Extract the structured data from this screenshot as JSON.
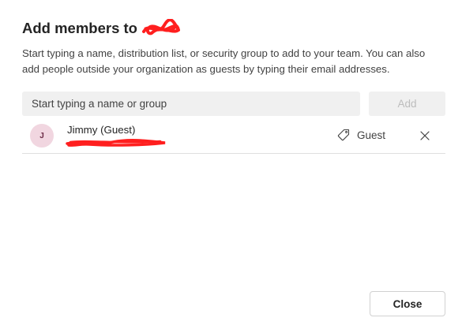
{
  "dialog": {
    "title": "Add members to",
    "description": "Start typing a name, distribution list, or security group to add to your team. You can also add people outside your organization as guests by typing their email addresses."
  },
  "search": {
    "placeholder": "Start typing a name or group",
    "value": ""
  },
  "add_button": {
    "label": "Add"
  },
  "members": [
    {
      "initial": "J",
      "name": "Jimmy (Guest)",
      "role": "Guest",
      "role_icon": "tag-icon",
      "remove_icon": "close-icon"
    }
  ],
  "footer": {
    "close_label": "Close"
  },
  "colors": {
    "redaction": "#ff1f1f",
    "avatar_bg": "#f1d6e0",
    "input_bg": "#f0f0f0"
  }
}
